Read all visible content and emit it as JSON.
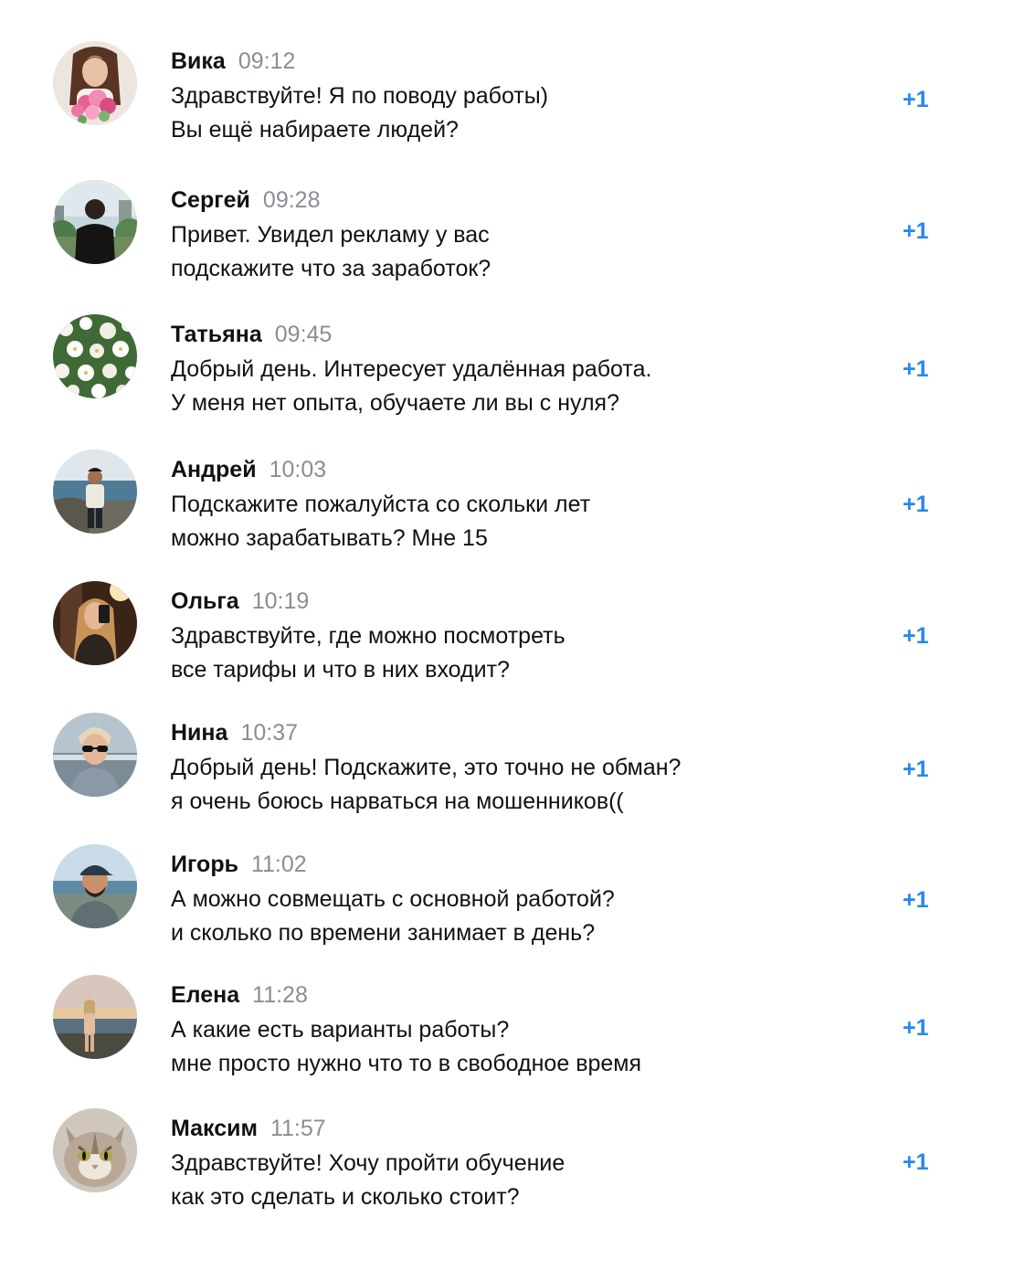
{
  "accent_color": "#2688eb",
  "messages": [
    {
      "author": "Вика",
      "time": "09:12",
      "lines": [
        "Здравствуйте! Я по поводу работы)",
        "Вы ещё набираете людей?"
      ],
      "reaction": "+1",
      "avatar_icon": "woman-with-flowers-photo"
    },
    {
      "author": "Сергей",
      "time": "09:28",
      "lines": [
        "Привет. Увидел рекламу у вас",
        "подскажите что за заработок?"
      ],
      "reaction": "+1",
      "avatar_icon": "man-back-view-photo"
    },
    {
      "author": "Татьяна",
      "time": "09:45",
      "lines": [
        "Добрый день. Интересует удалённая работа.",
        "У меня нет опыта, обучаете ли вы с нуля?"
      ],
      "reaction": "+1",
      "avatar_icon": "white-flowers-photo"
    },
    {
      "author": "Андрей",
      "time": "10:03",
      "lines": [
        "Подскажите пожалуйста со скольки лет",
        "можно зарабатывать? Мне 15"
      ],
      "reaction": "+1",
      "avatar_icon": "man-at-sea-photo"
    },
    {
      "author": "Ольга",
      "time": "10:19",
      "lines": [
        "Здравствуйте, где можно посмотреть",
        "все тарифы и что в них входит?"
      ],
      "reaction": "+1",
      "avatar_icon": "woman-mirror-selfie-photo"
    },
    {
      "author": "Нина",
      "time": "10:37",
      "lines": [
        "Добрый день! Подскажите, это точно не обман?",
        "я очень боюсь нарваться на мошенников(("
      ],
      "reaction": "+1",
      "avatar_icon": "person-sunglasses-photo"
    },
    {
      "author": "Игорь",
      "time": "11:02",
      "lines": [
        "А можно совмещать с основной работой?",
        "и сколько по времени занимает в день?"
      ],
      "reaction": "+1",
      "avatar_icon": "man-cap-photo"
    },
    {
      "author": "Елена",
      "time": "11:28",
      "lines": [
        "А какие есть варианты работы?",
        "мне просто нужно что то в свободное время"
      ],
      "reaction": "+1",
      "avatar_icon": "woman-beach-sunset-photo"
    },
    {
      "author": "Максим",
      "time": "11:57",
      "lines": [
        "Здравствуйте! Хочу пройти обучение",
        "как это сделать и сколько стоит?"
      ],
      "reaction": "+1",
      "avatar_icon": "cat-photo"
    }
  ]
}
